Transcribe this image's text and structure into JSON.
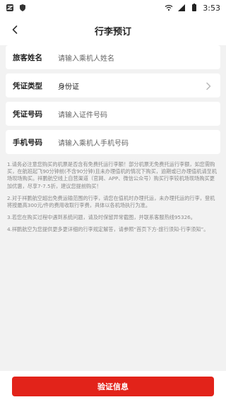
{
  "status_bar": {
    "time": "3:53",
    "left_icons": [
      "app-icon",
      "shield-icon"
    ],
    "right_icons": [
      "wifi-icon",
      "signal-icon",
      "battery-icon"
    ]
  },
  "header": {
    "title": "行李预订",
    "back_icon": "chevron-left-icon"
  },
  "form": {
    "fields": [
      {
        "label": "旅客姓名",
        "placeholder": "请输入乘机人姓名",
        "value": ""
      },
      {
        "label": "凭证类型",
        "placeholder": "",
        "value": "身份证",
        "has_arrow": true
      },
      {
        "label": "凭证号码",
        "placeholder": "请输入证件号码",
        "value": ""
      },
      {
        "label": "手机号码",
        "placeholder": "请输入乘机人手机号码",
        "value": ""
      }
    ]
  },
  "notes": [
    "1.请务必注意您购买的机票是否含有免费托运行李额！部分机票无免费托运行李额，如您需购买，在航班起飞90分钟前(不含90分钟)且未办理值机的情况下购买，逾期或已办理值机请至机场现场购买。祥鹏航空线上自营渠道（官网、APP、微信公众号）购买行李较机场现场购买更加优惠，尽享7-7.5折，建议您提前购买！",
    "2.对于祥鹏航空超出免费运输范围的行李，请您在值机时办理托运，未办理托运的行李，登机将按最高300元/件的费用收取行李费，具体以各机场执行为准。",
    "3.若您在购买过程中遇到系统问题，请及时保留异常截图，并联系客服热线95326。",
    "4.祥鹏航空为您提供更多更详细的行李规定解答，请参照“首页下方-旅行须知-行李须知”。"
  ],
  "footer": {
    "button_label": "验证信息"
  },
  "colors": {
    "accent": "#e2231a",
    "background": "#f2f2f2"
  }
}
